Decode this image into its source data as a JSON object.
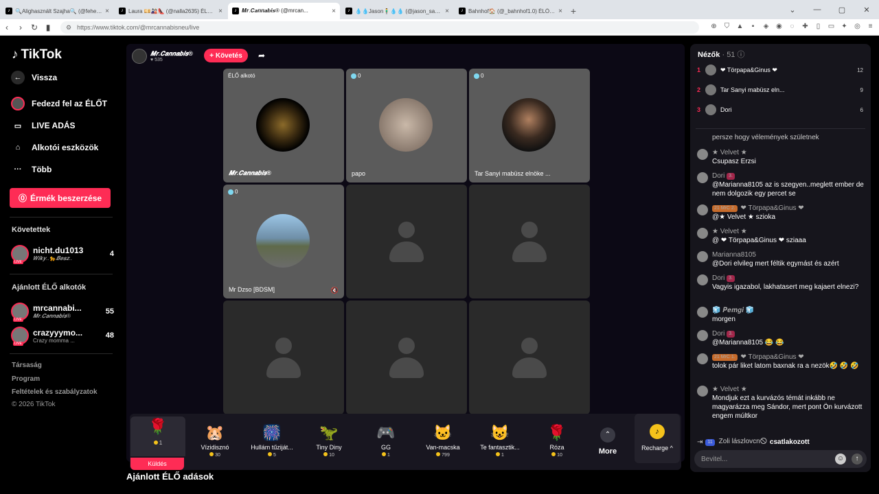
{
  "browser": {
    "tabs": [
      {
        "label": "🔍Alighasznált Szajha🔍 (@feherfa..."
      },
      {
        "label": "Laura 💴🎎👠 (@nalla2635) ÉLŐ adá..."
      },
      {
        "label": "𝑴𝒓.𝑪𝒂𝒏𝒏𝒂𝒃𝒊𝒔® (@mrcan..."
      },
      {
        "label": "💧💧Jason🧍‍♂️💧💧 (@jason_samara..."
      },
      {
        "label": "Bahnhof🏠 (@_bahnhof1.0) ÉLŐ adá..."
      }
    ],
    "url": "https://www.tiktok.com/@mrcannabisneu/live"
  },
  "sidebar": {
    "logo": "TikTok",
    "back": "Vissza",
    "nav": [
      {
        "label": "Fedezd fel az ÉLŐT"
      },
      {
        "label": "LIVE ADÁS"
      },
      {
        "label": "Alkotói eszközök"
      },
      {
        "label": "Több"
      }
    ],
    "buy_button": "Érmék beszerzése",
    "following_title": "Követettek",
    "following": [
      {
        "name": "nicht.du1013",
        "sub": "𝑾𝒊𝒌𝒚..🐆𝑩𝒆𝒔𝒛..",
        "count": "4"
      }
    ],
    "recommended_title": "Ajánlott ÉLŐ alkotók",
    "recommended": [
      {
        "name": "mrcannabi...",
        "sub": "𝑴𝒓.𝑪𝒂𝒏𝒏𝒂𝒃𝒊𝒔®",
        "count": "55"
      },
      {
        "name": "crazyyymo...",
        "sub": "Crazy momma ...",
        "count": "48"
      }
    ],
    "footer": [
      "Társaság",
      "Program",
      "Feltételek és szabályzatok",
      "© 2026 TikTok"
    ]
  },
  "stream": {
    "host_name": "𝑴𝒓.𝑪𝒂𝒏𝒏𝒂𝒃𝒊𝒔®",
    "host_likes": "♥ 535",
    "follow_label": "+ Követés",
    "cells": [
      {
        "label": "𝑴𝒓.𝑪𝒂𝒏𝒏𝒂𝒃𝒊𝒔®",
        "badge": "ÉLŐ alkotó"
      },
      {
        "label": "papo",
        "badge": "0"
      },
      {
        "label": "Tar Sanyi mabüsz elnöke ...",
        "badge": "0"
      },
      {
        "label": "Mr Dzso [BDSM]",
        "badge": "0"
      }
    ]
  },
  "gifts": {
    "items": [
      {
        "name": "",
        "price": "1",
        "icon": "🌹",
        "action": "Küldés"
      },
      {
        "name": "Vízidisznó",
        "price": "30",
        "icon": "🐹"
      },
      {
        "name": "Hullám tűziját...",
        "price": "5",
        "icon": "🎆"
      },
      {
        "name": "Tiny Diny",
        "price": "10",
        "icon": "🦖"
      },
      {
        "name": "GG",
        "price": "1",
        "icon": "🎮"
      },
      {
        "name": "Van-macska",
        "price": "799",
        "icon": "🐱"
      },
      {
        "name": "Te fantasztik...",
        "price": "1",
        "icon": "😺"
      },
      {
        "name": "Róza",
        "price": "10",
        "icon": "🌹"
      }
    ],
    "more_label": "More",
    "recharge_label": "Recharge ^"
  },
  "recommended_live_title": "Ajánlott ÉLŐ adások",
  "chat": {
    "viewers_title": "Nézők",
    "viewers_count": "· 51",
    "top_viewers": [
      {
        "rank": "1",
        "name": "❤ Törpapa&Ginus ❤",
        "count": "12"
      },
      {
        "rank": "2",
        "name": "Tar Sanyi mabüsz eln...",
        "count": "9"
      },
      {
        "rank": "3",
        "name": "Dori",
        "count": "6"
      }
    ],
    "partial_line": "persze hogy vélemények születnek",
    "messages": [
      {
        "user": "★ Velvet ★",
        "tags": "",
        "text": "Csupasz Erzsi"
      },
      {
        "user": "Dori",
        "tags": "3.",
        "text": "@Marianna8105 az is szegyen..meglett ember de nem dolgozik egy percet se"
      },
      {
        "user": "❤ Törpapa&Ginus ❤",
        "tags": "21 MrC 2.",
        "text": "@★ Velvet ★ szioka"
      },
      {
        "user": "★ Velvet ★",
        "tags": "",
        "text": "@ ❤ Törpapa&Ginus ❤ sziaaa"
      },
      {
        "user": "Marianna8105",
        "tags": "",
        "text": "@Dori elvileg mert féltik egymást és azért"
      },
      {
        "user": "Dori",
        "tags": "3.",
        "text": "Vagyis igazabol, lakhatasert meg kajaert elnezi?"
      },
      {
        "user": "🧊 𝑷𝒆𝒎𝒈𝒊 🧊",
        "tags": "",
        "text": "morgen"
      },
      {
        "user": "Dori",
        "tags": "3.",
        "text": "@Marianna8105 😂 😂"
      },
      {
        "user": "❤ Törpapa&Ginus ❤",
        "tags": "21 MrC 1.",
        "text": "tolok pár liket latom baxnak ra a nezök🤣 🤣 🤣"
      },
      {
        "user": "★ Velvet ★",
        "tags": "",
        "text": "Mondjuk ezt a kurvázós témát inkább ne magyarázza meg Sándor, mert pont Ön kurvázott engem múltkor"
      }
    ],
    "joined_level": "11",
    "joined_user": "Zoli lászlovcn🛇",
    "joined_text": "csatlakozott",
    "input_placeholder": "Bevitel..."
  }
}
